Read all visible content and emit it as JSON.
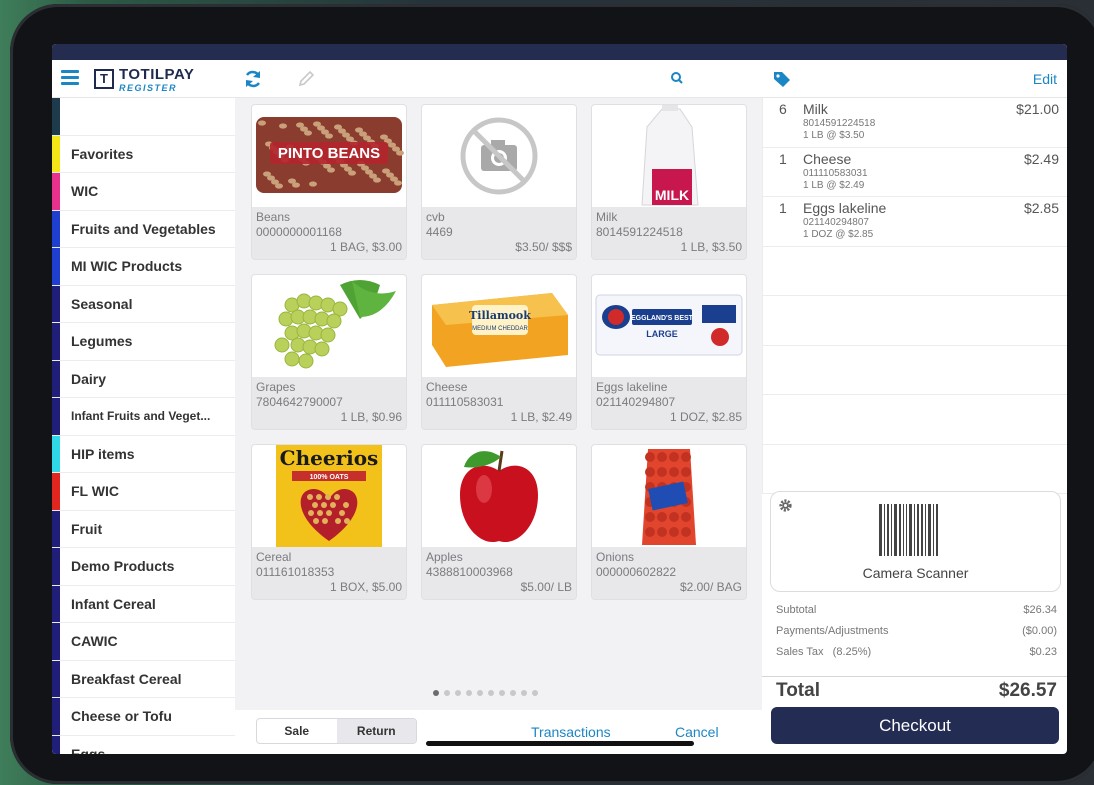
{
  "app": {
    "logo_name": "TOTILPAY",
    "logo_sub": "REGISTER",
    "logo_mark": "T"
  },
  "header": {
    "edit_label": "Edit"
  },
  "categories": [
    {
      "label": "",
      "color": "#1e3b4c"
    },
    {
      "label": "Favorites",
      "color": "#f5e617"
    },
    {
      "label": "WIC",
      "color": "#e8318c"
    },
    {
      "label": "Fruits and Vegetables",
      "color": "#1f3fd1"
    },
    {
      "label": "MI WIC Products",
      "color": "#1f3fd1"
    },
    {
      "label": "Seasonal",
      "color": "#1f1f7a"
    },
    {
      "label": "Legumes",
      "color": "#1f1f7a"
    },
    {
      "label": "Dairy",
      "color": "#1f1f7a"
    },
    {
      "label": "Infant Fruits and Veget...",
      "color": "#1f1f7a"
    },
    {
      "label": "HIP items",
      "color": "#2ed8e6"
    },
    {
      "label": "FL WIC",
      "color": "#e0261f"
    },
    {
      "label": "Fruit",
      "color": "#1f1f7a"
    },
    {
      "label": "Demo Products",
      "color": "#1f1f7a"
    },
    {
      "label": "Infant Cereal",
      "color": "#1f1f7a"
    },
    {
      "label": "CAWIC",
      "color": "#1f1f7a"
    },
    {
      "label": "Breakfast Cereal",
      "color": "#1f1f7a"
    },
    {
      "label": "Cheese or Tofu",
      "color": "#1f1f7a"
    },
    {
      "label": "Eggs",
      "color": "#1f1f7a"
    }
  ],
  "products": [
    {
      "name": "Beans",
      "code": "0000000001168",
      "price": "1 BAG, $3.00",
      "image": "pinto-beans"
    },
    {
      "name": "cvb",
      "code": "4469",
      "price": "$3.50/ $$$",
      "image": "no-photo"
    },
    {
      "name": "Milk",
      "code": "8014591224518",
      "price": "1 LB, $3.50",
      "image": "milk-jug"
    },
    {
      "name": "Grapes",
      "code": "7804642790007",
      "price": "1 LB, $0.96",
      "image": "grapes"
    },
    {
      "name": "Cheese",
      "code": "011110583031",
      "price": "1 LB, $2.49",
      "image": "cheese-block"
    },
    {
      "name": "Eggs lakeline",
      "code": "021140294807",
      "price": "1 DOZ, $2.85",
      "image": "egg-carton"
    },
    {
      "name": "Cereal",
      "code": "011161018353",
      "price": "1 BOX, $5.00",
      "image": "cereal-box"
    },
    {
      "name": "Apples",
      "code": "4388810003968",
      "price": "$5.00/ LB",
      "image": "apple"
    },
    {
      "name": "Onions",
      "code": "000000602822",
      "price": "$2.00/ BAG",
      "image": "onion-bag"
    }
  ],
  "product_images": {
    "beans_text": "PINTO BEANS",
    "milk_text": "MILK",
    "cheese_text": "Tillamook",
    "cheese_sub": "MEDIUM CHEDDAR",
    "eggs_text": "EGGLAND'S BEST",
    "eggs_sub": "LARGE",
    "cereal_text": "Cheerios",
    "cereal_sub": "100% OATS"
  },
  "pagination": {
    "pages": 10,
    "current": 1
  },
  "bottom": {
    "sale_label": "Sale",
    "return_label": "Return",
    "transactions_label": "Transactions",
    "cancel_label": "Cancel"
  },
  "cart": {
    "items": [
      {
        "qty": "6",
        "name": "Milk",
        "sku": "8014591224518",
        "unit": "1 LB @ $3.50",
        "amount": "$21.00"
      },
      {
        "qty": "1",
        "name": "Cheese",
        "sku": "011110583031",
        "unit": "1 LB @ $2.49",
        "amount": "$2.49"
      },
      {
        "qty": "1",
        "name": "Eggs lakeline",
        "sku": "021140294807",
        "unit": "1 DOZ @ $2.85",
        "amount": "$2.85"
      }
    ]
  },
  "scanner": {
    "label": "Camera Scanner"
  },
  "totals": {
    "subtotal_label": "Subtotal",
    "subtotal": "$26.34",
    "payments_label": "Payments/Adjustments",
    "payments": "($0.00)",
    "tax_label": "Sales Tax   (8.25%)",
    "tax": "$0.23",
    "total_label": "Total",
    "total": "$26.57"
  },
  "checkout_label": "Checkout",
  "colors": {
    "accent": "#1b86c4",
    "navy": "#232c52"
  }
}
